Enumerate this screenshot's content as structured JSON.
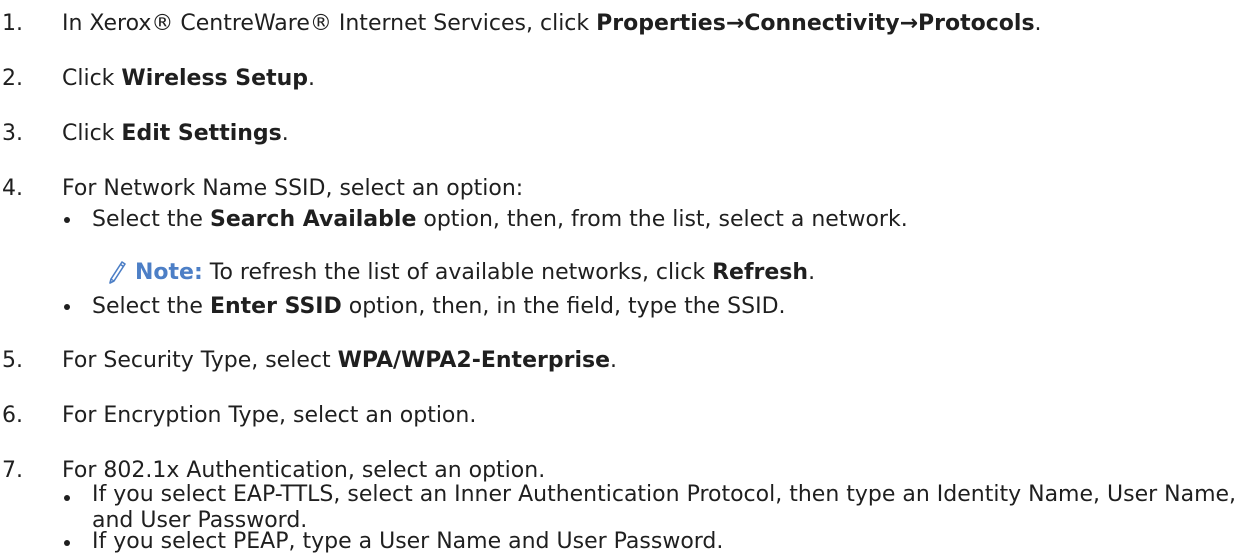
{
  "steps": [
    {
      "num": "1.",
      "pre": "In Xerox® CentreWare® Internet Services, click ",
      "bold": "Properties→Connectivity→Protocols",
      "post": "."
    },
    {
      "num": "2.",
      "pre": "Click ",
      "bold": "Wireless Setup",
      "post": "."
    },
    {
      "num": "3.",
      "pre": "Click ",
      "bold": "Edit Settings",
      "post": "."
    },
    {
      "num": "4.",
      "text": "For Network Name SSID, select an option:",
      "bullets": [
        {
          "pre": "Select the ",
          "bold": "Search Available",
          "post": " option, then, from the list, select a network."
        },
        {
          "pre": "Select the ",
          "bold": "Enter SSID",
          "post": " option, then, in the field, type the SSID."
        }
      ],
      "note": {
        "label": "Note:",
        "pre": " To refresh the list of available networks, click ",
        "bold": "Refresh",
        "post": "."
      }
    },
    {
      "num": "5.",
      "pre": "For Security Type, select ",
      "bold": "WPA/WPA2-Enterprise",
      "post": "."
    },
    {
      "num": "6.",
      "text": "For Encryption Type, select an option."
    },
    {
      "num": "7.",
      "text": "For 802.1x Authentication, select an option.",
      "bullets": [
        {
          "text": "If you select EAP-TTLS, select an Inner Authentication Protocol, then type an Identity Name, User Name, and User Password."
        },
        {
          "text": "If you select PEAP, type a User Name and User Password."
        }
      ]
    }
  ],
  "colors": {
    "text": "#1f1f1f",
    "note_accent": "#4d7fc6"
  },
  "icons": {
    "note": "pencil-icon"
  }
}
